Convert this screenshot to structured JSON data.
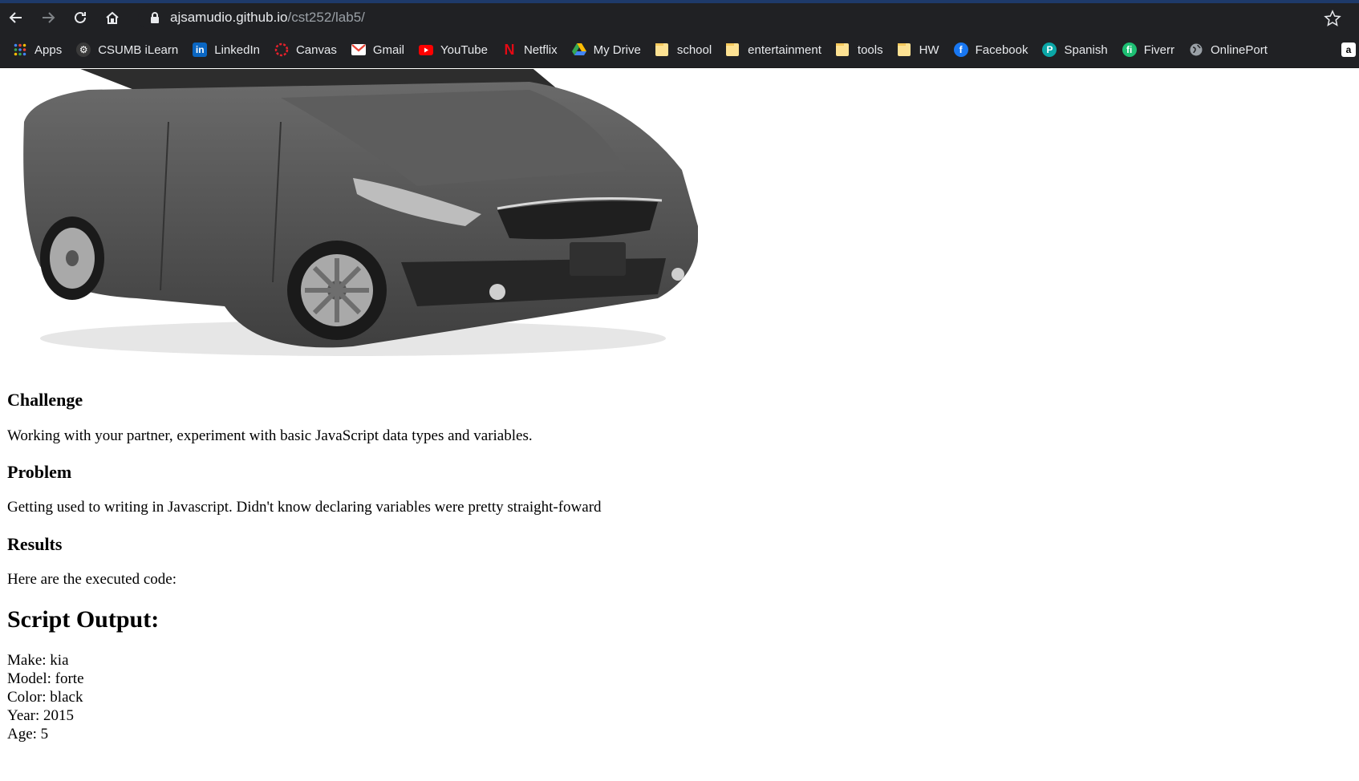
{
  "browser": {
    "url_host": "ajsamudio.github.io",
    "url_path": "/cst252/lab5/",
    "nav_icons": [
      "back-arrow-icon",
      "forward-arrow-icon",
      "reload-icon",
      "home-icon"
    ],
    "bookmarks": [
      {
        "label": "Apps",
        "icon": "apps-grid-icon"
      },
      {
        "label": "CSUMB iLearn",
        "icon": "ilearn-icon"
      },
      {
        "label": "LinkedIn",
        "icon": "linkedin-icon"
      },
      {
        "label": "Canvas",
        "icon": "canvas-icon"
      },
      {
        "label": "Gmail",
        "icon": "gmail-icon"
      },
      {
        "label": "YouTube",
        "icon": "youtube-icon"
      },
      {
        "label": "Netflix",
        "icon": "netflix-icon"
      },
      {
        "label": "My Drive",
        "icon": "google-drive-icon"
      },
      {
        "label": "school",
        "icon": "folder-icon"
      },
      {
        "label": "entertainment",
        "icon": "folder-icon"
      },
      {
        "label": "tools",
        "icon": "folder-icon"
      },
      {
        "label": "HW",
        "icon": "folder-icon"
      },
      {
        "label": "Facebook",
        "icon": "facebook-icon"
      },
      {
        "label": "Spanish",
        "icon": "spanish-icon"
      },
      {
        "label": "Fiverr",
        "icon": "fiverr-icon"
      },
      {
        "label": "OnlinePort",
        "icon": "globe-icon"
      }
    ],
    "colors": {
      "chrome": "#202124",
      "accent_strip": "#1e3a6a"
    }
  },
  "page": {
    "challenge": {
      "title": "Challenge",
      "text": "Working with your partner, experiment with basic JavaScript data types and variables."
    },
    "problem": {
      "title": "Problem",
      "text": "Getting used to writing in Javascript. Didn't know declaring variables were pretty straight-foward"
    },
    "results": {
      "title": "Results",
      "text": "Here are the executed code:"
    },
    "output": {
      "title": "Script Output:",
      "lines": [
        "Make: kia",
        "Model: forte",
        "Color: black",
        "Year: 2015",
        "Age: 5"
      ]
    }
  }
}
